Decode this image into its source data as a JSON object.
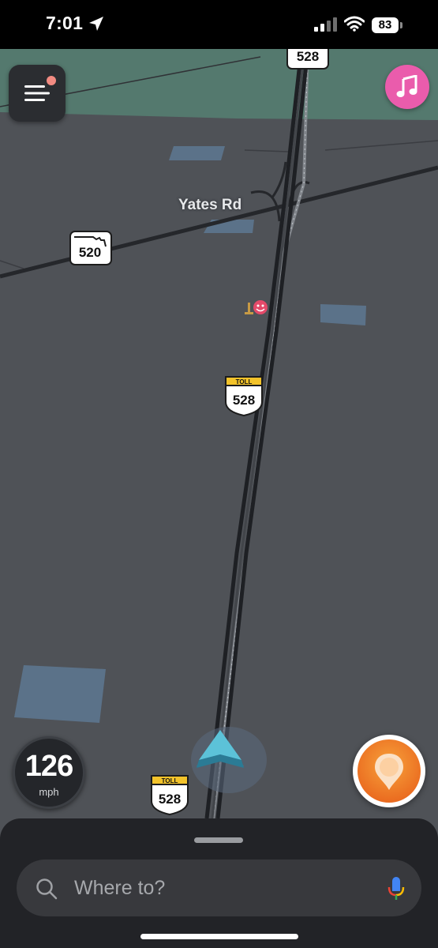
{
  "status_bar": {
    "time": "7:01",
    "location_icon": "location-arrow-icon",
    "signal_icon": "cellular-signal-icon",
    "wifi_icon": "wifi-icon",
    "battery": "83"
  },
  "map": {
    "street_label": "Yates Rd",
    "shields": [
      {
        "route": "528",
        "toll": false
      },
      {
        "route": "520",
        "toll": false
      },
      {
        "route": "528",
        "toll": true,
        "toll_label": "TOLL"
      },
      {
        "route": "528",
        "toll": true,
        "toll_label": "TOLL"
      }
    ],
    "colors": {
      "land": "#4f5257",
      "green_area": "#54796e",
      "water": "#5b7289",
      "road": "#2a2c30",
      "rail": "#8a8e94"
    }
  },
  "controls": {
    "menu_icon": "hamburger-menu-icon",
    "music_icon": "music-note-icon",
    "music_color": "#ea5cac",
    "report_icon": "report-pin-icon",
    "report_color": "#f0812b",
    "vehicle_icon": "navigation-arrow-icon",
    "vehicle_color": "#4fb6cf"
  },
  "speedometer": {
    "value": "126",
    "unit": "mph"
  },
  "search": {
    "placeholder": "Where to?",
    "search_icon": "search-icon",
    "mic_icon": "microphone-icon"
  }
}
